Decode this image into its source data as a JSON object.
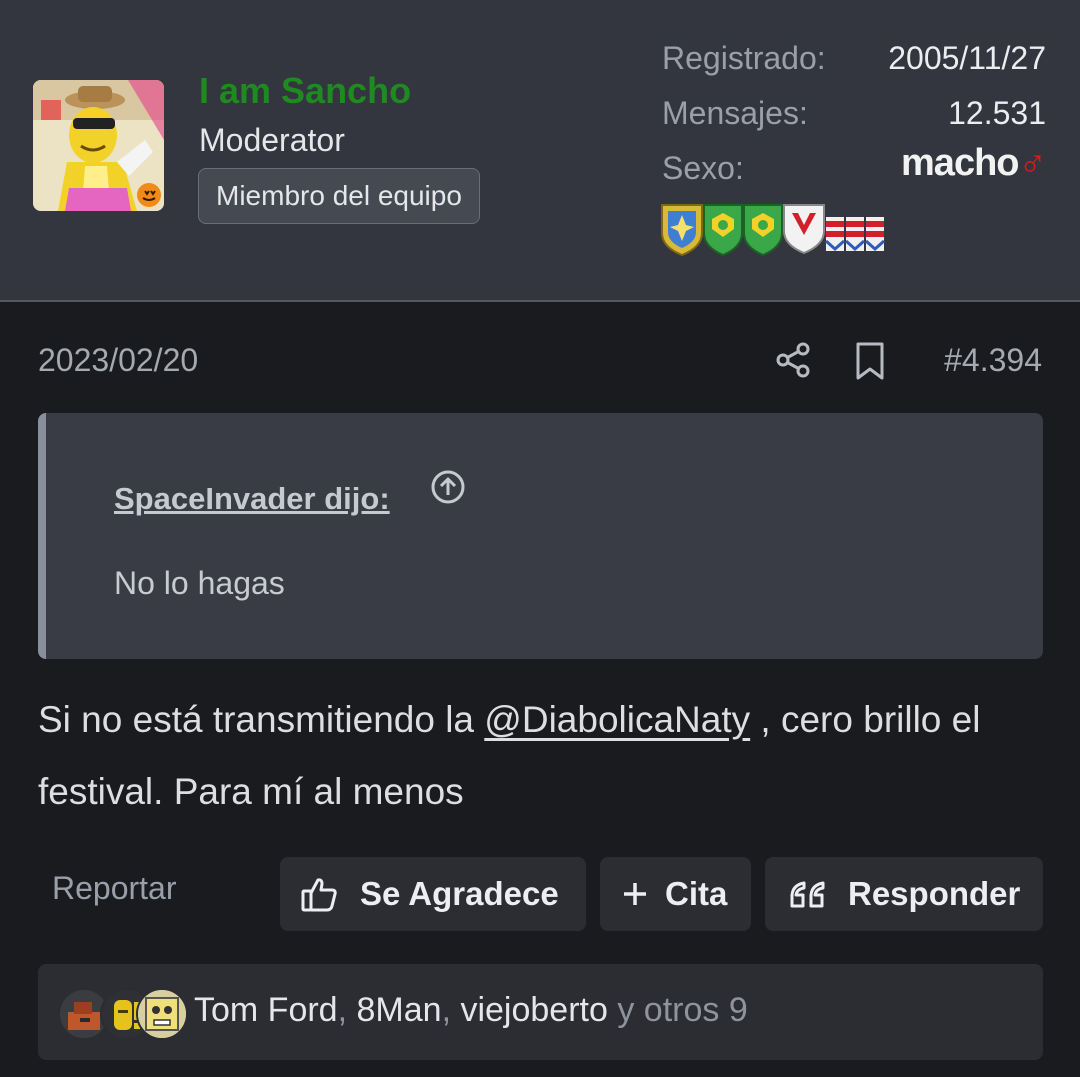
{
  "user": {
    "username": "I am Sancho",
    "title": "Moderator",
    "badge": "Miembro del equipo",
    "username_color": "#1f8a1f"
  },
  "stats": {
    "registered_label": "Registrado:",
    "registered_value": "2005/11/27",
    "messages_label": "Mensajes:",
    "messages_value": "12.531",
    "gender_label": "Sexo:",
    "gender_value": "macho"
  },
  "post": {
    "date": "2023/02/20",
    "number": "#4.394",
    "quote": {
      "author_link": "SpaceInvader dijo:",
      "text": "No lo hagas"
    },
    "body_before": "Si no está transmitiendo la ",
    "mention": "@DiabolicaNaty",
    "body_after": " , cero brillo el festival. Para mí al menos"
  },
  "actions": {
    "report": "Reportar",
    "thanks": "Se Agradece",
    "quote": "Cita",
    "reply": "Responder"
  },
  "reactions": {
    "users": [
      "Tom Ford",
      "8Man",
      "viejoberto"
    ],
    "separator": ", ",
    "others": " y otros 9"
  },
  "icons": {
    "share": "share-icon",
    "bookmark": "bookmark-icon",
    "quote_jump": "arrow-up-circle-icon",
    "thumbs_up": "thumbs-up-icon",
    "plus": "plus-icon",
    "quote_marks": "quote-marks-icon",
    "gender": "mars-symbol-icon"
  }
}
